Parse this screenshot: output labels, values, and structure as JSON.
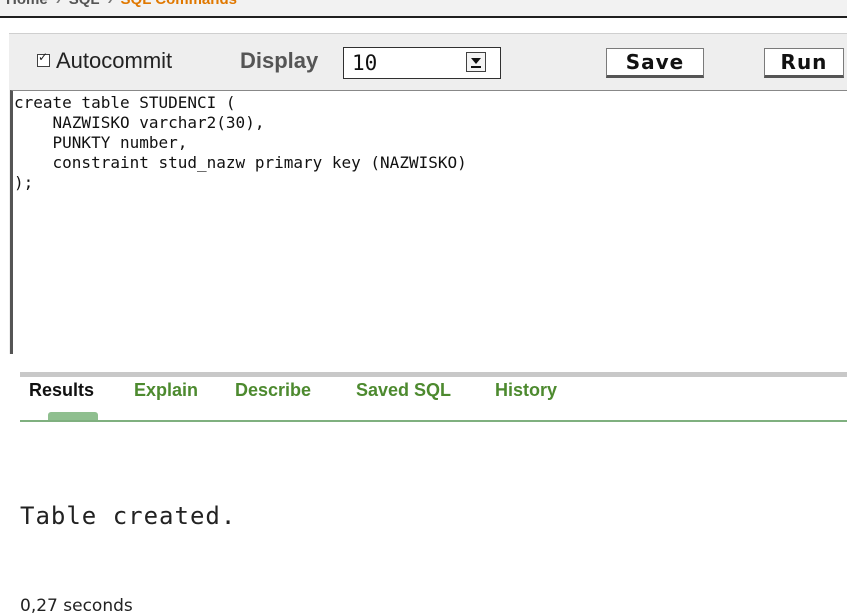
{
  "breadcrumb": {
    "items": [
      "Home",
      "SQL",
      "SQL Commands"
    ]
  },
  "toolbar": {
    "autocommit_label": "Autocommit",
    "autocommit_checked": true,
    "display_label": "Display",
    "display_value": "10",
    "save_label": "Save",
    "run_label": "Run"
  },
  "editor": {
    "content": "create table STUDENCI (\n    NAZWISKO varchar2(30),\n    PUNKTY number,\n    constraint stud_nazw primary key (NAZWISKO)\n);"
  },
  "tabs": [
    {
      "label": "Results",
      "active": true
    },
    {
      "label": "Explain",
      "active": false
    },
    {
      "label": "Describe",
      "active": false
    },
    {
      "label": "Saved SQL",
      "active": false
    },
    {
      "label": "History",
      "active": false
    }
  ],
  "result": {
    "message": "Table created.",
    "elapsed": "0,27 seconds"
  },
  "colors": {
    "tab_link": "#4d8a2f",
    "breadcrumb_current": "#e07800",
    "panel_bg": "#eeeeee"
  }
}
